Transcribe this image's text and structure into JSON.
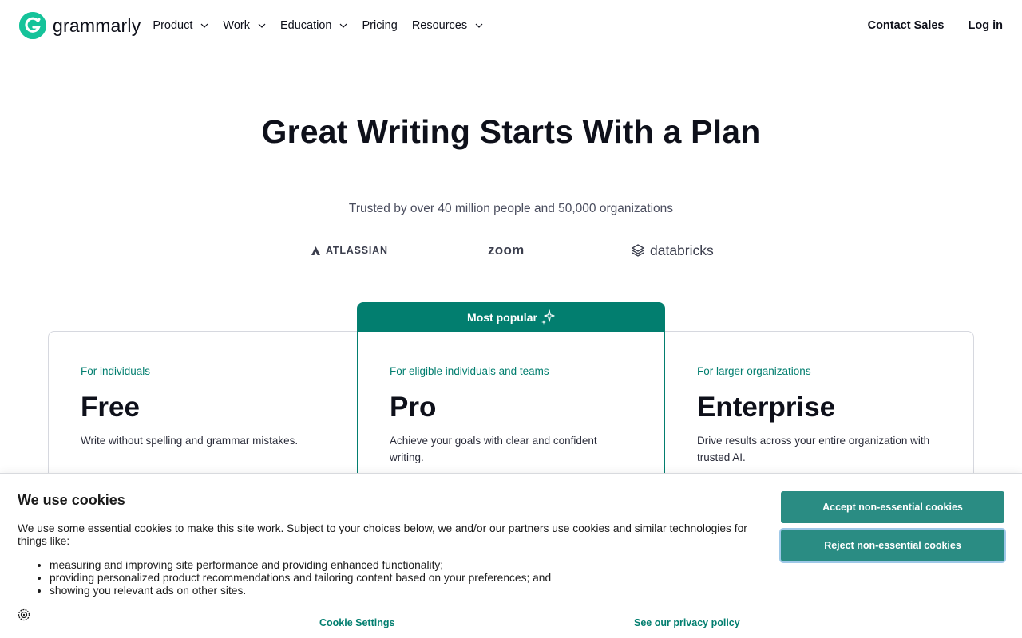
{
  "header": {
    "logo_text": "grammarly",
    "nav": [
      {
        "label": "Product",
        "dropdown": true
      },
      {
        "label": "Work",
        "dropdown": true
      },
      {
        "label": "Education",
        "dropdown": true
      },
      {
        "label": "Pricing",
        "dropdown": false
      },
      {
        "label": "Resources",
        "dropdown": true
      }
    ],
    "contact_sales": "Contact Sales",
    "log_in": "Log in"
  },
  "hero": {
    "title": "Great Writing Starts With a Plan",
    "trusted": "Trusted by over 40 million people and 50,000 organizations",
    "logos": [
      "ATLASSIAN",
      "zoom",
      "databricks"
    ]
  },
  "plans": {
    "popular_label": "Most popular",
    "items": [
      {
        "for": "For individuals",
        "name": "Free",
        "desc": "Write without spelling and grammar mistakes."
      },
      {
        "for": "For eligible individuals and teams",
        "name": "Pro",
        "desc": "Achieve your goals with clear and confident writing."
      },
      {
        "for": "For larger organizations",
        "name": "Enterprise",
        "desc": "Drive results across your entire organization with trusted AI."
      }
    ]
  },
  "cookie": {
    "title": "We use cookies",
    "text": "We use some essential cookies to make this site work. Subject to your choices below, we and/or our partners use cookies and similar technologies for things like:",
    "list": [
      "measuring and improving site performance and providing enhanced functionality;",
      "providing personalized product recommendations and tailoring content based on your preferences; and",
      "showing you relevant ads on other sites."
    ],
    "accept": "Accept non-essential cookies",
    "reject": "Reject non-essential cookies",
    "settings": "Cookie Settings",
    "privacy": "See our privacy policy"
  },
  "colors": {
    "brand_green": "#15c39a",
    "accent_teal": "#027e6f",
    "button_teal": "#2a8c83"
  }
}
